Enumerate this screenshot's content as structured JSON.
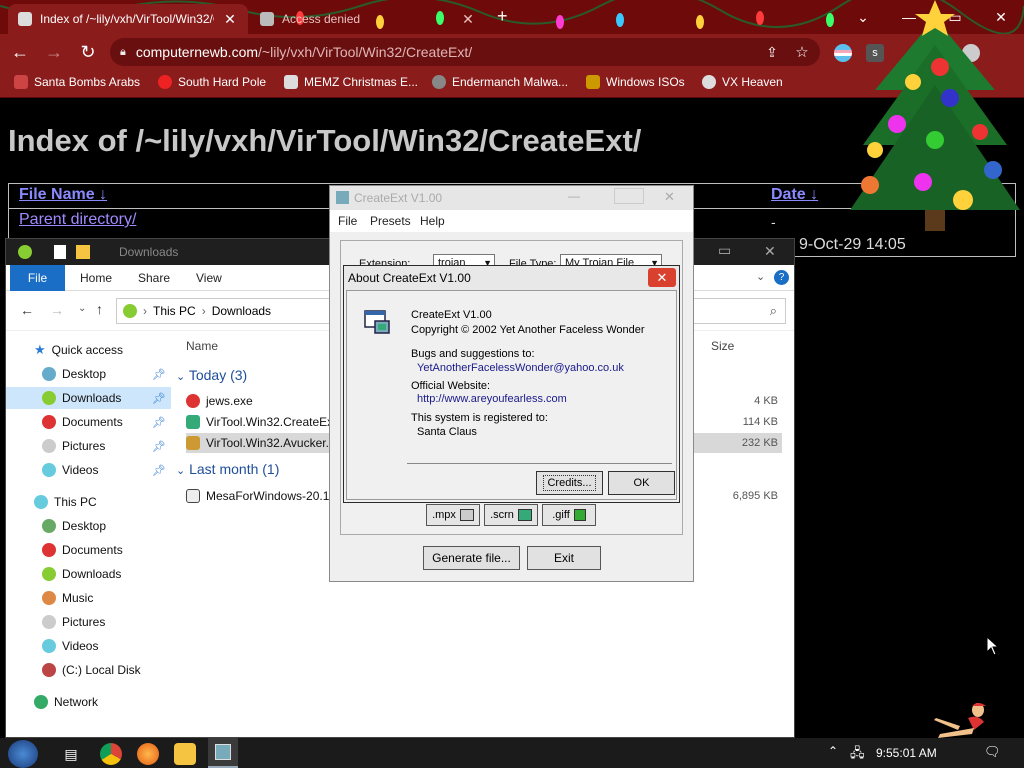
{
  "browser": {
    "tabs": [
      {
        "title": "Index of /~lily/vxh/VirTool/Win32/CreateExt/",
        "active": true
      },
      {
        "title": "Access denied",
        "active": false
      }
    ],
    "url_host": "computernewb.com",
    "url_path": "/~lily/vxh/VirTool/Win32/CreateExt/",
    "bookmarks": [
      "Santa Bombs Arabs",
      "South Hard Pole",
      "MEMZ Christmas E...",
      "Endermanch Malwa...",
      "Windows ISOs",
      "VX Heaven"
    ],
    "extension_letter": "s"
  },
  "page": {
    "title": "Index of /~lily/vxh/VirTool/Win32/CreateExt/",
    "col_name": "File Name",
    "col_date": "Date",
    "sort_arrow": "↓",
    "parent_link": "Parent directory/",
    "parent_date": "-",
    "row_date": "9-Oct-29 14:05"
  },
  "explorer": {
    "title": "Downloads",
    "ribbon_tabs": [
      "File",
      "Home",
      "Share",
      "View"
    ],
    "address": [
      "This PC",
      "Downloads"
    ],
    "nav": [
      {
        "label": "Quick access"
      },
      {
        "label": "Desktop"
      },
      {
        "label": "Downloads"
      },
      {
        "label": "Documents"
      },
      {
        "label": "Pictures"
      },
      {
        "label": "Videos"
      },
      {
        "label": "This PC"
      },
      {
        "label": "Desktop"
      },
      {
        "label": "Documents"
      },
      {
        "label": "Downloads"
      },
      {
        "label": "Music"
      },
      {
        "label": "Pictures"
      },
      {
        "label": "Videos"
      },
      {
        "label": "(C:) Local Disk"
      },
      {
        "label": "Network"
      }
    ],
    "col_name": "Name",
    "col_size": "Size",
    "groups": [
      "Today (3)",
      "Last month (1)"
    ],
    "files": [
      {
        "name": "jews.exe",
        "size": "4 KB"
      },
      {
        "name": "VirTool.Win32.CreateEx",
        "size": "114 KB"
      },
      {
        "name": "VirTool.Win32.Avucker.",
        "size": "232 KB"
      },
      {
        "name": "MesaForWindows-20.1",
        "size": "6,895 KB"
      }
    ]
  },
  "createext": {
    "title": "CreateExt V1.00",
    "menu": [
      "File",
      "Presets",
      "Help"
    ],
    "extension_label": "Extension:",
    "extension_value": "trojan",
    "filetype_label": "File Type:",
    "filetype_value": "My Trojan File",
    "small_buttons": [
      ".mpx",
      ".scrn",
      ".giff"
    ],
    "generate_label": "Generate file...",
    "exit_label": "Exit"
  },
  "about": {
    "title": "About CreateExt V1.00",
    "close_glyph": "✕",
    "app_name": "CreateExt V1.00",
    "copyright": "Copyright © 2002 Yet Another Faceless Wonder",
    "bugs_label": "Bugs and suggestions to:",
    "email": "YetAnotherFacelessWonder@yahoo.co.uk",
    "website_label": "Official Website:",
    "website": "http://www.areyoufearless.com",
    "registered_label": "This system is registered to:",
    "registered_to": "Santa Claus",
    "credits_label": "Credits...",
    "ok_label": "OK"
  },
  "taskbar": {
    "time": "9:55:01 AM"
  },
  "colors": {
    "chrome_dark": "#6e0a0a",
    "chrome": "#8a1c1c",
    "link": "#8a8aff",
    "accent_blue": "#1a6ec6"
  }
}
